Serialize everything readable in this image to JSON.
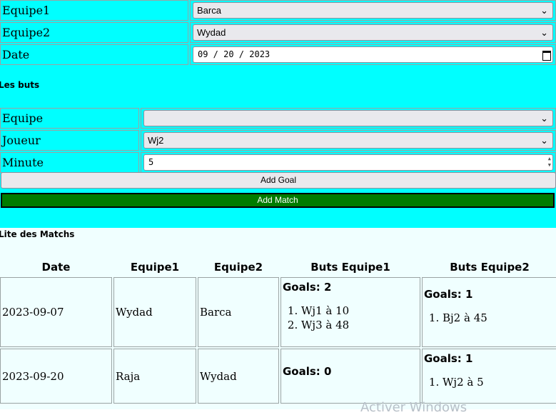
{
  "form": {
    "equipe1_label": "Equipe1",
    "equipe1_value": "Barca",
    "equipe2_label": "Equipe2",
    "equipe2_value": "Wydad",
    "date_label": "Date",
    "date_value": "09 / 20 / 2023"
  },
  "goals_section": {
    "title": "Les buts",
    "equipe_label": "Equipe",
    "equipe_value": "",
    "joueur_label": "Joueur",
    "joueur_value": "Wj2",
    "minute_label": "Minute",
    "minute_value": "5",
    "add_goal_label": "Add Goal",
    "add_match_label": "Add Match"
  },
  "matches": {
    "title": "Lite des Matchs",
    "headers": [
      "Date",
      "Equipe1",
      "Equipe2",
      "Buts Equipe1",
      "Buts Equipe2"
    ],
    "rows": [
      {
        "date": "2023-09-07",
        "equipe1": "Wydad",
        "equipe2": "Barca",
        "buts1_title": "Goals: 2",
        "buts1": [
          "Wj1 à 10",
          "Wj3 à 48"
        ],
        "buts2_title": "Goals: 1",
        "buts2": [
          "Bj2 à 45"
        ]
      },
      {
        "date": "2023-09-20",
        "equipe1": "Raja",
        "equipe2": "Wydad",
        "buts1_title": "Goals: 0",
        "buts1": [],
        "buts2_title": "Goals: 1",
        "buts2": [
          "Wj2 à 5"
        ]
      }
    ]
  },
  "watermark": "Activer Windows",
  "colors": {
    "form_bg": "#00ffff",
    "list_bg": "#f0ffff",
    "match_button": "#007c00"
  },
  "icons": {
    "select": "chevron-down-icon",
    "date": "calendar-icon",
    "number": "spinner-icon"
  }
}
